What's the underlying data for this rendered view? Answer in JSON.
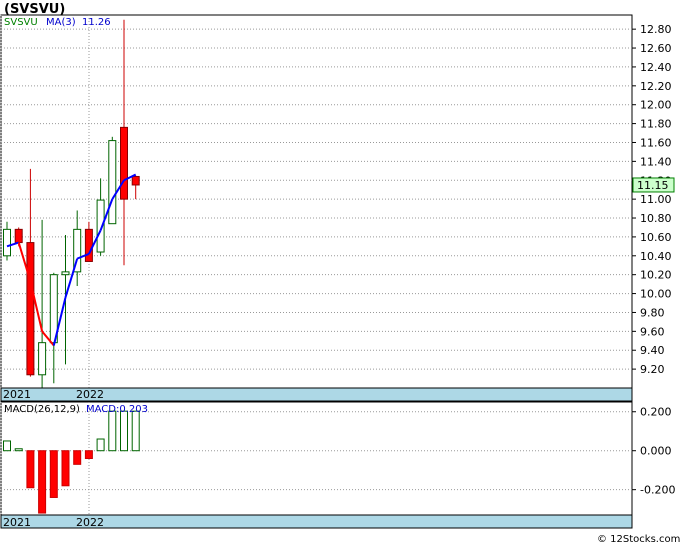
{
  "chart_data": [
    {
      "type": "candlestick",
      "title": "(SVSVU)",
      "legend": {
        "symbol_label": "SVSVU",
        "ma_label": "MA(3)",
        "ma_value": "11.26"
      },
      "last_price_label": "11.15",
      "ylim": [
        9.0,
        12.95
      ],
      "y_ticks": [
        "9.20",
        "9.40",
        "9.60",
        "9.80",
        "10.00",
        "10.20",
        "10.40",
        "10.60",
        "10.80",
        "11.00",
        "11.20",
        "11.40",
        "11.60",
        "11.80",
        "12.00",
        "12.20",
        "12.40",
        "12.60",
        "12.80"
      ],
      "x_labels": [
        "2021",
        "2022"
      ],
      "candles": [
        {
          "o": 10.4,
          "h": 10.76,
          "l": 10.35,
          "c": 10.68
        },
        {
          "o": 10.68,
          "h": 10.7,
          "l": 10.5,
          "c": 10.54
        },
        {
          "o": 10.54,
          "h": 11.32,
          "l": 9.12,
          "c": 9.14
        },
        {
          "o": 9.14,
          "h": 10.78,
          "l": 9.0,
          "c": 9.48
        },
        {
          "o": 9.48,
          "h": 10.22,
          "l": 9.05,
          "c": 10.2
        },
        {
          "o": 10.2,
          "h": 10.62,
          "l": 9.25,
          "c": 10.23
        },
        {
          "o": 10.23,
          "h": 10.88,
          "l": 10.08,
          "c": 10.68
        },
        {
          "o": 10.68,
          "h": 10.76,
          "l": 10.34,
          "c": 10.34
        },
        {
          "o": 10.44,
          "h": 11.22,
          "l": 10.4,
          "c": 10.99
        },
        {
          "o": 10.74,
          "h": 11.66,
          "l": 10.74,
          "c": 11.62
        },
        {
          "o": 11.76,
          "h": 12.9,
          "l": 10.3,
          "c": 11.0
        },
        {
          "o": 11.24,
          "h": 11.25,
          "l": 11.0,
          "c": 11.15
        }
      ],
      "ma_values": [
        10.5,
        10.54,
        10.13,
        9.6,
        9.45,
        9.96,
        10.37,
        10.42,
        10.67,
        11.0,
        11.2,
        11.26
      ]
    },
    {
      "type": "bar",
      "title": "MACD(26,12,9)",
      "value_label": "MACD:0.203",
      "ylim": [
        -0.33,
        0.25
      ],
      "y_ticks": [
        "-0.200",
        "0.000",
        "0.200"
      ],
      "x_labels": [
        "2021",
        "2022"
      ],
      "values": [
        0.05,
        0.01,
        -0.19,
        -0.32,
        -0.24,
        -0.18,
        -0.07,
        -0.04,
        0.06,
        0.203,
        0.203,
        0.203
      ]
    }
  ],
  "footer": {
    "credit": "© 12Stocks.com"
  }
}
